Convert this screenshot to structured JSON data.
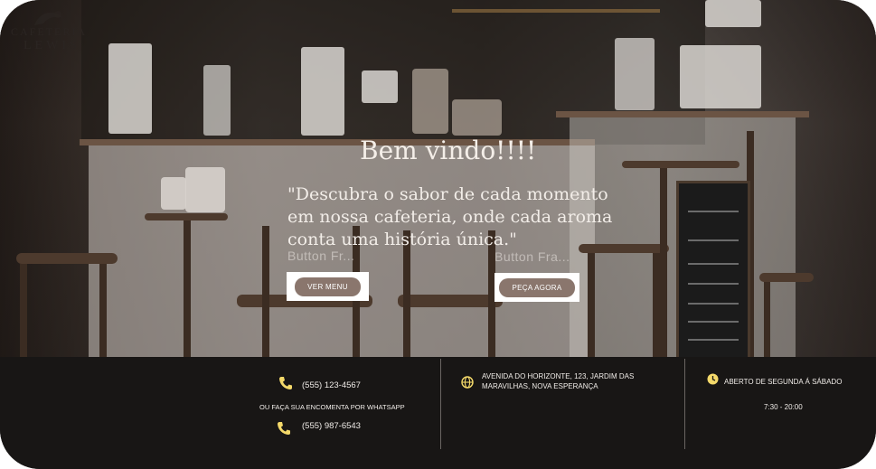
{
  "brand": {
    "line1": "CAFETERIA",
    "line2": "LEWIS"
  },
  "hero": {
    "title": "Bem vindo!!!!",
    "tagline_lines": [
      "\"Descubra o sabor de cada momento",
      "em nossa cafeteria, onde cada aroma",
      "conta uma história única.\""
    ],
    "ghost_label_left": "Button Fr...",
    "ghost_label_right": "Button Fra...",
    "menu_button": "VER MENU",
    "order_button": "PEÇA AGORA"
  },
  "footer": {
    "phone": "(555) 123-4567",
    "whatsapp_label": "OU FAÇA SUA ENCOMENTA POR WHATSAPP",
    "whatsapp_phone": "(555) 987-6543",
    "address_line1": "AVENIDA DO HORIZONTE, 123, JARDIM DAS",
    "address_line2": "MARAVILHAS, NOVA ESPERANÇA",
    "hours_label": "ABERTO DE SEGUNDA Á SÁBADO",
    "hours_time": "7:30 - 20:00"
  },
  "colors": {
    "accent_button": "#8a766d",
    "icon_yellow": "#f4d96a",
    "footer_bg": "#181615"
  },
  "icons": [
    "logo-mark-icon",
    "phone-icon",
    "whatsapp-phone-icon",
    "globe-icon",
    "clock-icon"
  ]
}
